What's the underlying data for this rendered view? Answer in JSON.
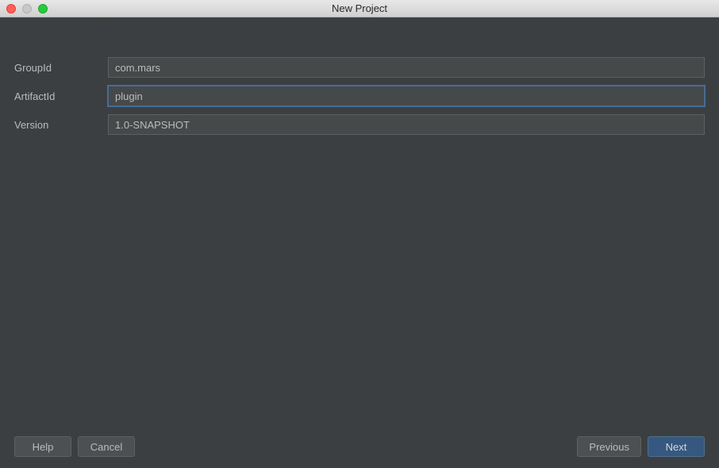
{
  "window": {
    "title": "New Project"
  },
  "form": {
    "group_label": "GroupId",
    "group_value": "com.mars",
    "artifact_label": "ArtifactId",
    "artifact_value": "plugin",
    "version_label": "Version",
    "version_value": "1.0-SNAPSHOT"
  },
  "buttons": {
    "help": "Help",
    "cancel": "Cancel",
    "previous": "Previous",
    "next": "Next"
  }
}
